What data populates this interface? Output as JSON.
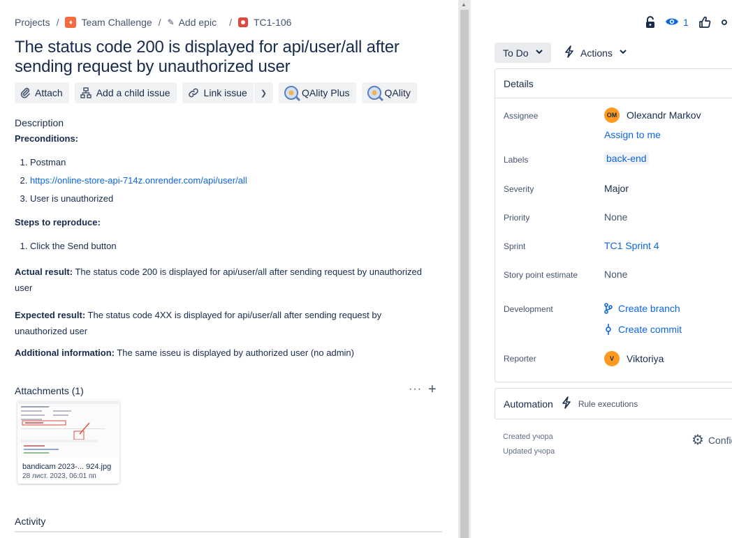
{
  "breadcrumb": {
    "projects": "Projects",
    "project": "Team Challenge",
    "add_epic": "Add epic",
    "issue_key": "TC1-106"
  },
  "issue": {
    "title": "The status code 200 is displayed for api/user/all after sending request by unauthorized user"
  },
  "toolbar": {
    "attach": "Attach",
    "add_child": "Add a child issue",
    "link_issue": "Link issue",
    "qality_plus": "QAlity Plus",
    "qality": "QAlity"
  },
  "description": {
    "label": "Description",
    "preconditions_heading": "Preconditions:",
    "preconditions": [
      "Postman",
      "https://online-store-api-714z.onrender.com/api/user/all",
      "User is unauthorized"
    ],
    "steps_heading": "Steps to reproduce:",
    "steps": [
      "Click the Send button"
    ],
    "actual_label": "Actual result:",
    "actual_text": " The status code 200 is displayed for api/user/all after sending request by unauthorized user",
    "expected_label": "Expected result:",
    "expected_text": "  The status code 4XX is displayed for api/user/all after sending request by unauthorized user",
    "additional_label": "Additional information:",
    "additional_text": " The same isseu is displayed by authorized user (no admin)"
  },
  "attachments": {
    "heading": "Attachments (1)",
    "more": "···",
    "add": "+",
    "file_name": "bandicam 2023-... 924.jpg",
    "file_date": "28 лист. 2023, 06:01 пп"
  },
  "activity": {
    "heading": "Activity"
  },
  "top_actions": {
    "watchers_count": "1"
  },
  "status": {
    "label": "To Do",
    "actions": "Actions"
  },
  "details": {
    "heading": "Details",
    "assignee_label": "Assignee",
    "assignee_initials": "OM",
    "assignee_name": "Olexandr Markov",
    "assign_to_me": "Assign to me",
    "labels_label": "Labels",
    "label_value": "back-end",
    "severity_label": "Severity",
    "severity_value": "Major",
    "priority_label": "Priority",
    "priority_value": "None",
    "sprint_label": "Sprint",
    "sprint_value": "TC1 Sprint 4",
    "story_points_label": "Story point estimate",
    "story_points_value": "None",
    "development_label": "Development",
    "create_branch": "Create branch",
    "create_commit": "Create commit",
    "reporter_label": "Reporter",
    "reporter_initial": "V",
    "reporter_name": "Viktoriya"
  },
  "automation": {
    "heading": "Automation",
    "rule_executions": "Rule executions"
  },
  "meta": {
    "created": "Created учора",
    "updated": "Updated учора",
    "configure": "Configure"
  },
  "colors": {
    "link": "#0c66e4",
    "assignee_avatar": "#ff991f",
    "reporter_avatar": "#ff991f",
    "bug_icon": "#e2483d",
    "project_icon": "#f56a3e"
  }
}
